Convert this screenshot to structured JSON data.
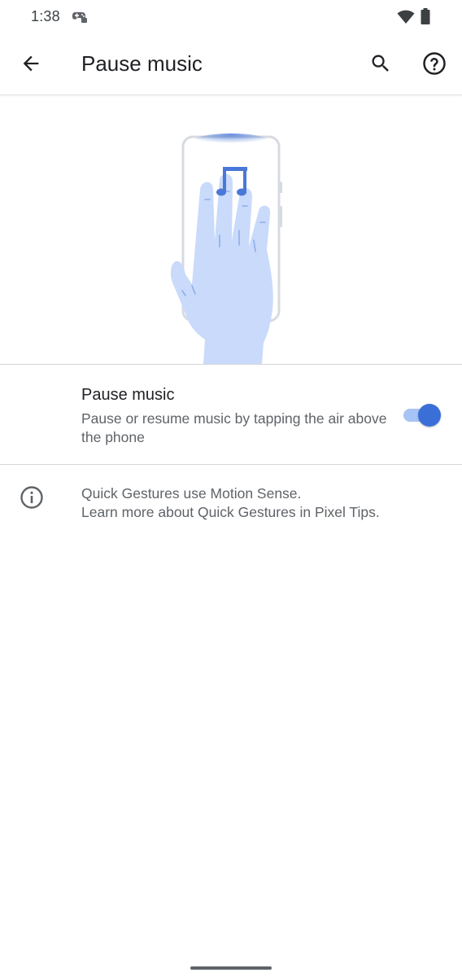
{
  "status_bar": {
    "time": "1:38",
    "icons": [
      "game-controller-icon",
      "wifi-icon",
      "battery-icon"
    ]
  },
  "app_bar": {
    "title": "Pause music",
    "back_icon": "arrow-back-icon",
    "search_icon": "search-icon",
    "help_icon": "help-icon"
  },
  "illustration": {
    "description_icon": "music-note-icon",
    "hand_color": "#c9dafb",
    "accent_color": "#4a78d8"
  },
  "setting": {
    "title": "Pause music",
    "summary": "Pause or resume music by tapping the air above the phone",
    "enabled": true,
    "accent_color": "#3b6fd8"
  },
  "info": {
    "icon": "info-icon",
    "line1": "Quick Gestures use Motion Sense.",
    "line2": "Learn more about Quick Gestures in Pixel Tips."
  }
}
